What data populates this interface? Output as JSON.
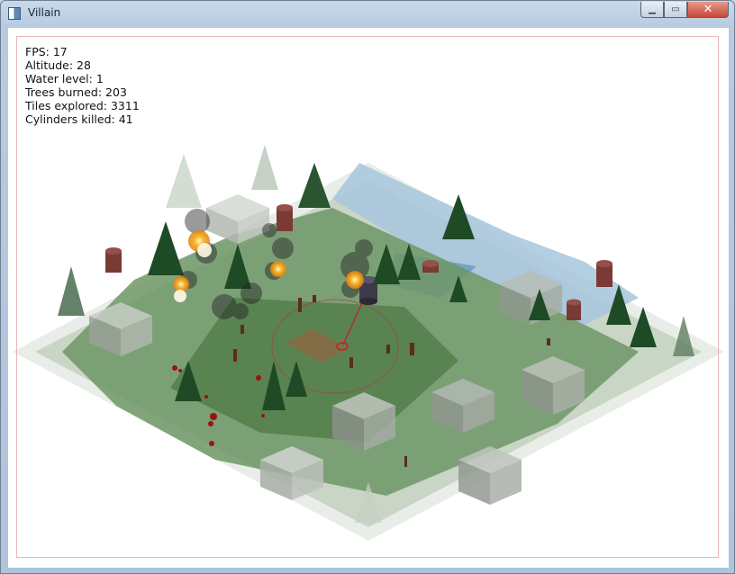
{
  "window": {
    "title": "Villain",
    "controls": {
      "minimize": "▁",
      "maximize": "▭",
      "close": "✕"
    }
  },
  "hud": {
    "fps": "FPS: 17",
    "altitude": "Altitude: 28",
    "water_level": "Water level: 1",
    "trees_burned": "Trees burned: 203",
    "tiles_explored": "Tiles explored: 3311",
    "cylinders_killed": "Cylinders killed: 41"
  },
  "colors": {
    "grass": "#5f8a55",
    "grass_dark": "#4d6f46",
    "stone": "#9aa39b",
    "water": "#7aa3c6",
    "tree": "#1f4a26",
    "cylinder": "#7a3a35",
    "fire": "#f0a020",
    "selection": "#b04b2d"
  }
}
